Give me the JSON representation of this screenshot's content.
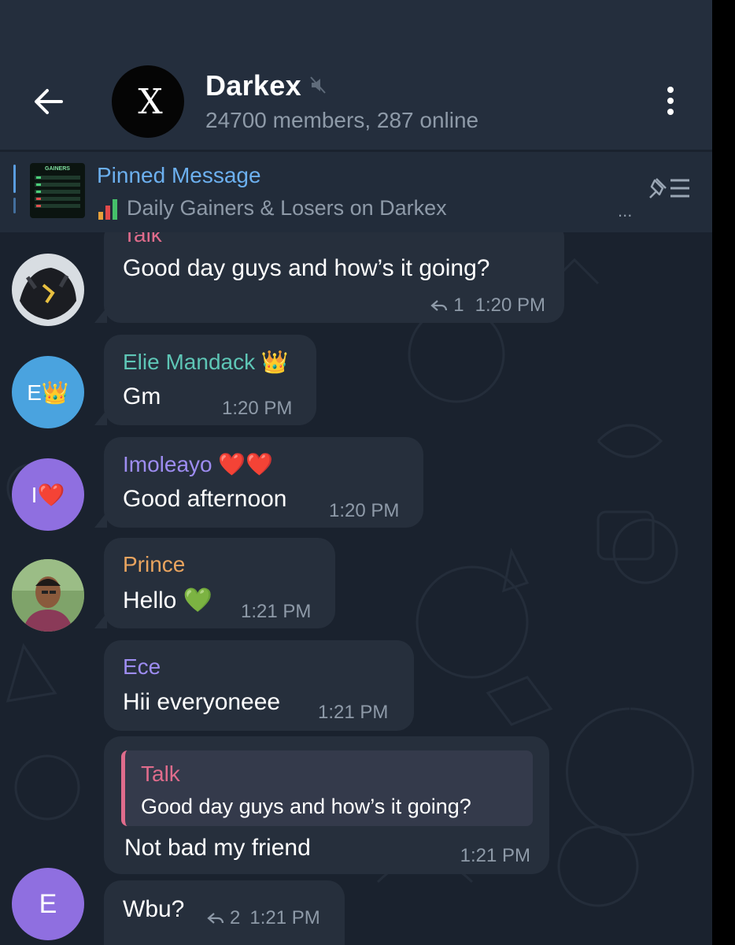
{
  "header": {
    "title": "Darkex",
    "subtitle": "24700 members, 287 online",
    "avatar_text": "X"
  },
  "pinned": {
    "title": "Pinned Message",
    "text": "Daily Gainers & Losers on Darkex",
    "thumb_text": "GAINERS",
    "more": "..."
  },
  "messages": [
    {
      "sender": "Talk",
      "text": "Good day guys and how’s it going?",
      "replies": "1",
      "time": "1:20 PM"
    },
    {
      "sender": "Elie Mandack",
      "sender_emoji": "👑",
      "avatar_text": "E👑",
      "text": "Gm",
      "time": "1:20 PM"
    },
    {
      "sender": "Imoleayo",
      "sender_emoji": "❤️❤️",
      "avatar_text": "I❤️",
      "text": "Good afternoon",
      "time": "1:20 PM"
    },
    {
      "sender": "Prince",
      "text": "Hello",
      "text_emoji": "💚",
      "time": "1:21 PM"
    },
    {
      "sender": "Ece",
      "text": "Hii everyoneee",
      "time": "1:21 PM"
    },
    {
      "quote_sender": "Talk",
      "quote_text": "Good day guys and how’s it going?",
      "text": "Not bad my friend",
      "time": "1:21 PM"
    },
    {
      "avatar_text": "E",
      "text": "Wbu?",
      "replies": "2",
      "time": "1:21 PM"
    }
  ],
  "colors": {
    "background": "#1a222e",
    "header": "#242e3d",
    "bubble": "#262f3c",
    "elie_name": "#5ec6b6",
    "imoleayo_name": "#9d8cf0",
    "prince_name": "#e9a45f",
    "ece_name": "#9d8cf0",
    "talk_name": "#e06c8c",
    "pinned_title": "#6cb0ef"
  }
}
